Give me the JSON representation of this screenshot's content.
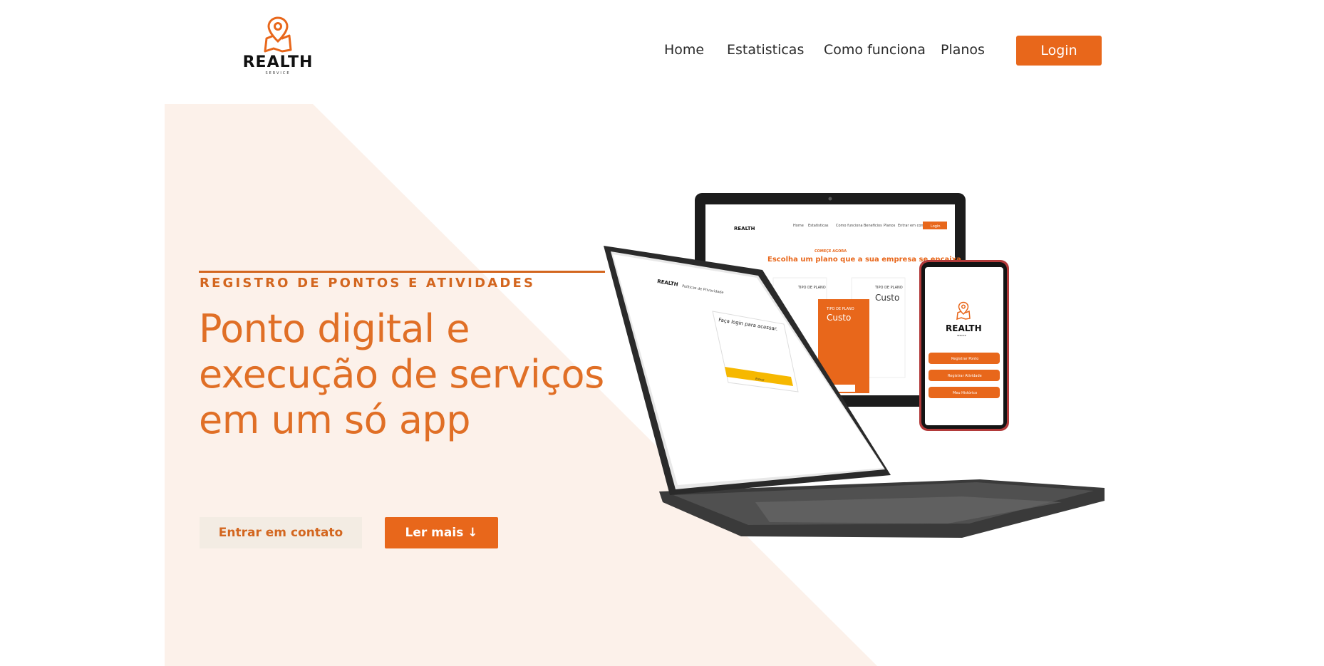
{
  "brand": {
    "name": "REALTH",
    "tagline": "SERVICE",
    "accent": "#e8671b"
  },
  "nav": {
    "items": [
      "Home",
      "Estatisticas",
      "Como funciona",
      "Planos"
    ],
    "login_label": "Login"
  },
  "hero": {
    "eyebrow": "REGISTRO DE PONTOS E ATIVIDADES",
    "title_lines": [
      "Ponto digital e",
      "execução de serviços",
      "em um só app"
    ],
    "contact_button": "Entrar em contato",
    "more_button": "Ler mais ↓",
    "background": "#fcf1ea"
  },
  "mockups": {
    "monitor": {
      "nav_items": [
        "Home",
        "Estatisticas",
        "Como funciona",
        "Beneficios",
        "Planos",
        "Entrar em contato"
      ],
      "login": "Login",
      "kicker": "COMEÇE AGORA",
      "headline": "Escolha um plano que a sua empresa se encaixa",
      "plan_label": "TIPO DE PLANO",
      "plan_name": "Custo"
    },
    "laptop": {
      "header": "Políticas de Privacidade",
      "form_title": "Faça login para acessar.",
      "button": "Entrar"
    },
    "phone": {
      "brand": "REALTH",
      "tagline": "SERVICE",
      "buttons": [
        "Registrar Ponto",
        "Registrar Atividade",
        "Meu Histórico"
      ]
    }
  }
}
